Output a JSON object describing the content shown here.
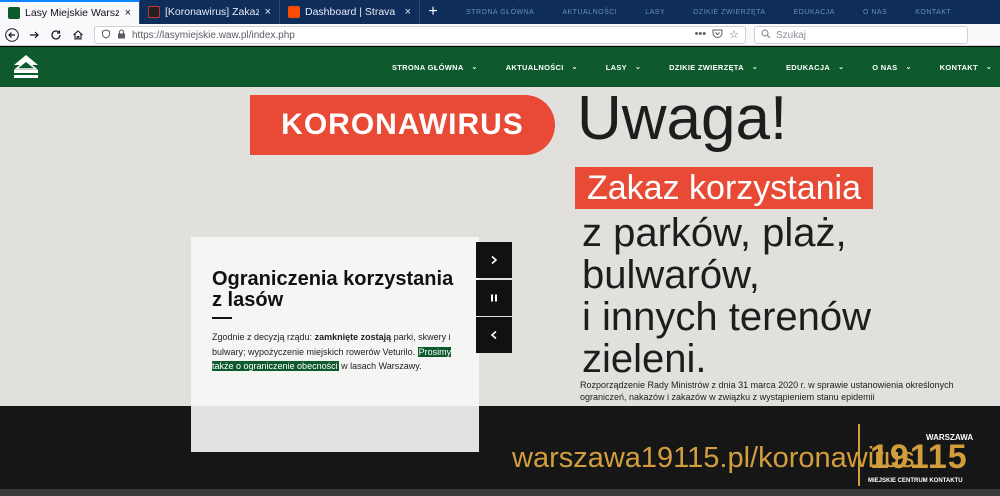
{
  "browser": {
    "tabs": [
      {
        "label": "Lasy Miejskie Warszawa - Stron",
        "active": true,
        "favicon_color": "#0e5a2c"
      },
      {
        "label": "[Koronawirus] Zakaz wychodze",
        "active": false,
        "favicon_color": "#222222"
      },
      {
        "label": "Dashboard | Strava",
        "active": false,
        "favicon_color": "#fc4c02"
      }
    ],
    "close_glyph": "×",
    "new_tab_glyph": "+",
    "url": "https://lasymiejskie.waw.pl/index.php",
    "search_placeholder": "Szukaj",
    "faded_tab_text": [
      "STRONA GŁÓWNA",
      "AKTUALNOŚCI",
      "LASY",
      "DZIKIE ZWIERZĘTA",
      "EDUKACJA",
      "O NAS",
      "KONTAKT"
    ]
  },
  "site": {
    "nav": [
      "STRONA GŁÓWNA",
      "AKTUALNOŚCI",
      "LASY",
      "DZIKIE ZWIERZĘTA",
      "EDUKACJA",
      "O NAS",
      "KONTAKT"
    ],
    "brand_color": "#0e5a2c"
  },
  "banner": {
    "pill": "KORONAWIRUS",
    "headline": "Uwaga!",
    "zakaz": "Zakaz korzystania",
    "lines": [
      "z parków, plaż,",
      "bulwarów,",
      "i innych terenów",
      "zieleni."
    ],
    "regulation": "Rozporządzenie Rady Ministrów z dnia 31 marca 2020 r. w sprawie ustanowienia określonych ograniczeń, nakazów i zakazów w związku z wystąpieniem stanu epidemii",
    "site_url": "warszawa19115.pl/koronawirus",
    "logo_number": "19115",
    "logo_city": "WARSZAWA",
    "logo_caption": "MIEJSKIE CENTRUM KONTAKTU",
    "accent_red": "#e84a36",
    "accent_gold": "#d29e3c"
  },
  "slide": {
    "title": "Ograniczenia korzystania z lasów",
    "text_before": "Zgodnie z decyzją rządu: ",
    "text_bold": "zamknięte zostają",
    "text_middle": " parki, skwery i bulwary; wypożyczenie miejskich rowerów Veturilo. ",
    "text_highlight": "Prosimy także o ograniczenie obecności",
    "text_after": " w lasach Warszawy.",
    "controls": [
      "next-icon",
      "pause-icon",
      "prev-icon"
    ]
  }
}
